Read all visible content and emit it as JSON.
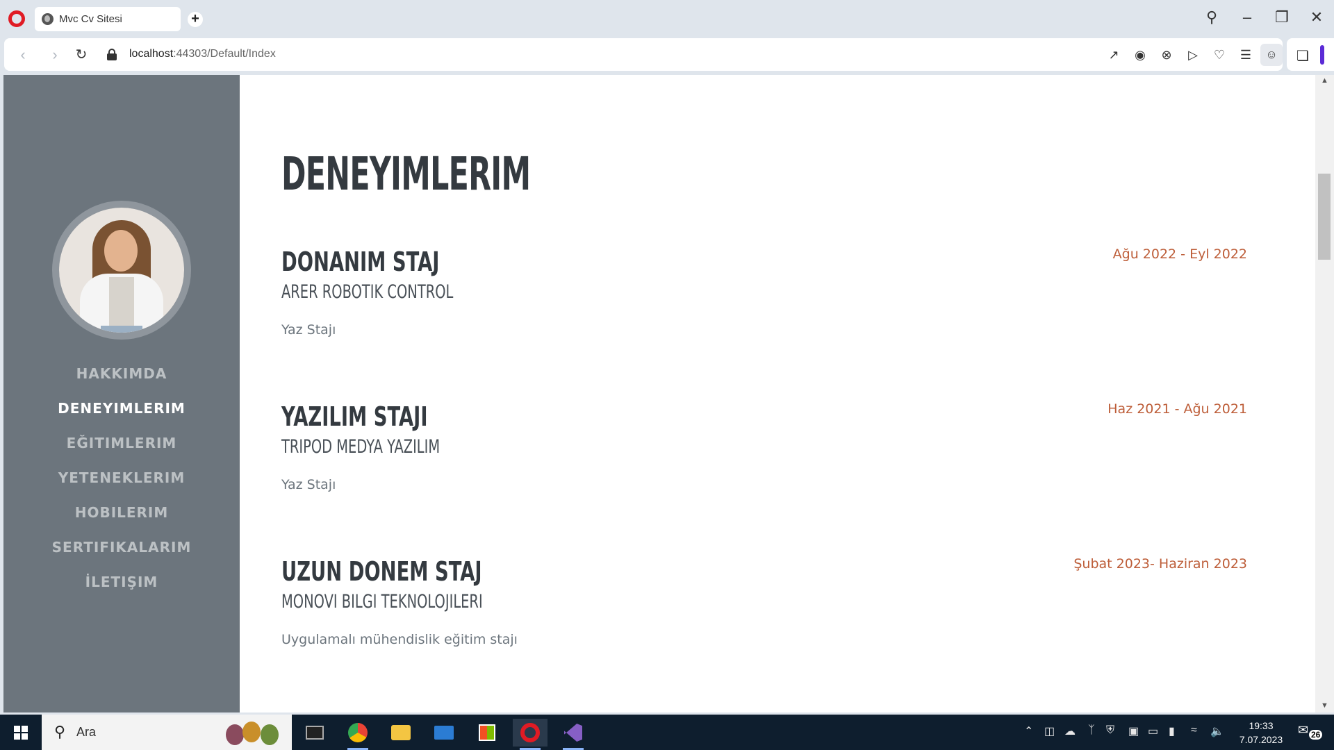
{
  "browser": {
    "tab_title": "Mvc Cv Sitesi",
    "url_host": "localhost",
    "url_rest": ":44303/Default/Index"
  },
  "sidebar": {
    "items": [
      {
        "label": "HAKKIMDA",
        "active": false
      },
      {
        "label": "DENEYIMLERIM",
        "active": true
      },
      {
        "label": "EĞITIMLERIM",
        "active": false
      },
      {
        "label": "YETENEKLERIM",
        "active": false
      },
      {
        "label": "HOBILERIM",
        "active": false
      },
      {
        "label": "SERTIFIKALARIM",
        "active": false
      },
      {
        "label": "İLETIŞIM",
        "active": false
      }
    ]
  },
  "main": {
    "title": "DENEYIMLERIM",
    "experiences": [
      {
        "title": "DONANIM STAJ",
        "company": "ARER ROBOTIK CONTROL",
        "description": "Yaz Stajı",
        "date": "Ağu 2022 - Eyl 2022"
      },
      {
        "title": "YAZILIM STAJI",
        "company": "TRIPOD MEDYA YAZILIM",
        "description": "Yaz Stajı",
        "date": "Haz 2021 - Ağu 2021"
      },
      {
        "title": "UZUN DONEM STAJ",
        "company": "MONOVI BILGI TEKNOLOJILERI",
        "description": "Uygulamalı mühendislik eğitim stajı",
        "date": "Şubat 2023- Haziran 2023"
      }
    ]
  },
  "taskbar": {
    "search_text": "Ara",
    "time": "19:33",
    "date": "7.07.2023",
    "notification_count": "26"
  },
  "colors": {
    "sidebar_bg": "#6c757d",
    "accent_date": "#bd5d38",
    "heading": "#343a40"
  }
}
